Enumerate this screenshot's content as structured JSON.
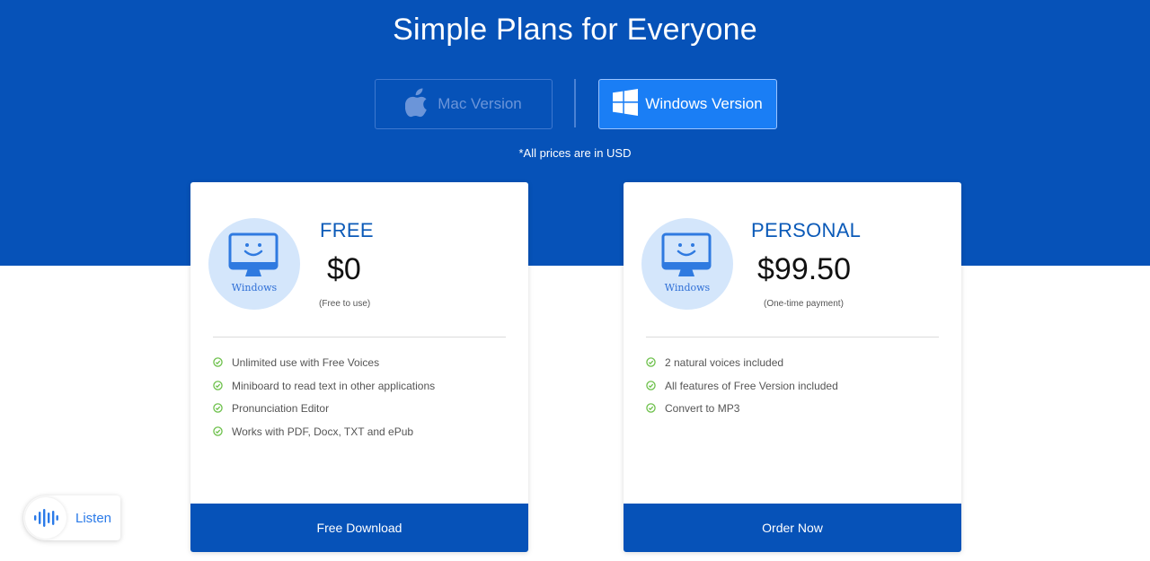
{
  "header": {
    "title": "Simple Plans for Everyone",
    "price_note": "*All prices are in USD"
  },
  "tabs": [
    {
      "label": "Mac Version",
      "icon": "apple-icon",
      "selected": false
    },
    {
      "label": "Windows Version",
      "icon": "windows-icon",
      "selected": true
    }
  ],
  "plans": [
    {
      "name": "FREE",
      "price": "$0",
      "price_note": "(Free to use)",
      "os_label": "Windows",
      "features": [
        "Unlimited use with Free Voices",
        "Miniboard to read text in other applications",
        "Pronunciation Editor",
        "Works with PDF, Docx, TXT and ePub"
      ],
      "cta": "Free Download"
    },
    {
      "name": "PERSONAL",
      "price": "$99.50",
      "price_note": "(One-time payment)",
      "os_label": "Windows",
      "features": [
        "2 natural voices included",
        "All features of Free Version included",
        "Convert to MP3"
      ],
      "cta": "Order Now"
    }
  ],
  "listen_widget": {
    "label": "Listen",
    "icon": "audio-wave-icon"
  },
  "colors": {
    "brand_blue": "#0652b8",
    "selected_tab": "#1a7ef5",
    "check_green": "#6cc04a"
  }
}
